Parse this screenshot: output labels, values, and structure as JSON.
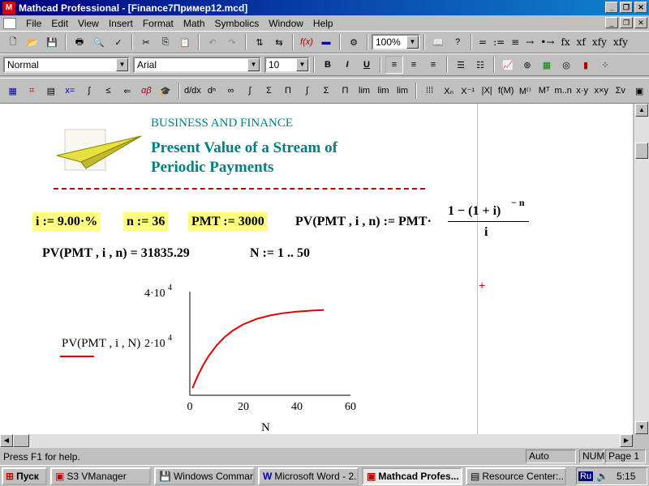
{
  "window": {
    "title": "Mathcad Professional - [Finance7Пример12.mcd]"
  },
  "menu": [
    "File",
    "Edit",
    "View",
    "Insert",
    "Format",
    "Math",
    "Symbolics",
    "Window",
    "Help"
  ],
  "toolbar": {
    "zoom": "100%"
  },
  "format_bar": {
    "style": "Normal",
    "font": "Arial",
    "size": "10"
  },
  "operators": [
    "=",
    ":=",
    "≡",
    "→",
    "•→",
    "fx",
    "xf",
    "xfy",
    "xfy"
  ],
  "worksheet": {
    "heading": "BUSINESS AND FINANCE",
    "title_line1": "Present Value of a Stream of",
    "title_line2": "Periodic Payments",
    "def_i": "i := 9.00·%",
    "def_n": "n := 36",
    "def_pmt": "PMT := 3000",
    "pv_def_lhs": "PV(PMT , i , n) := PMT·",
    "pv_num": "1 − (1 + i)",
    "pv_exp": "− n",
    "pv_den": "i",
    "pv_result": "PV(PMT , i , n) = 31835.29",
    "range_def": "N := 1 .. 50"
  },
  "chart_data": {
    "type": "line",
    "ylabel": "PV(PMT , i , N)",
    "xlabel": "N",
    "xlim": [
      0,
      60
    ],
    "ylim": [
      0,
      40000
    ],
    "xticks": [
      "0",
      "20",
      "40",
      "60"
    ],
    "ytick_4": "4·10",
    "ytick_2": "2·10",
    "ytick_exp": "4",
    "series": [
      {
        "color": "#e00000",
        "x": [
          1,
          2,
          3,
          5,
          7,
          10,
          13,
          16,
          20,
          25,
          30,
          35,
          40,
          45,
          50
        ],
        "y": [
          2752,
          5277,
          7594,
          11669,
          15098,
          19253,
          22460,
          24936,
          27386,
          29468,
          30821,
          31700,
          32272,
          32644,
          32886
        ]
      }
    ]
  },
  "status": {
    "help": "Press F1 for help.",
    "auto": "Auto",
    "num": "NUM",
    "page": "Page 1"
  },
  "taskbar": {
    "start": "Пуск",
    "items": [
      "S3 VManager",
      "Windows Comman...",
      "Microsoft Word - 2...",
      "Mathcad Profes...",
      "Resource Center:..."
    ],
    "lang": "Ru",
    "clock": "5:15"
  }
}
